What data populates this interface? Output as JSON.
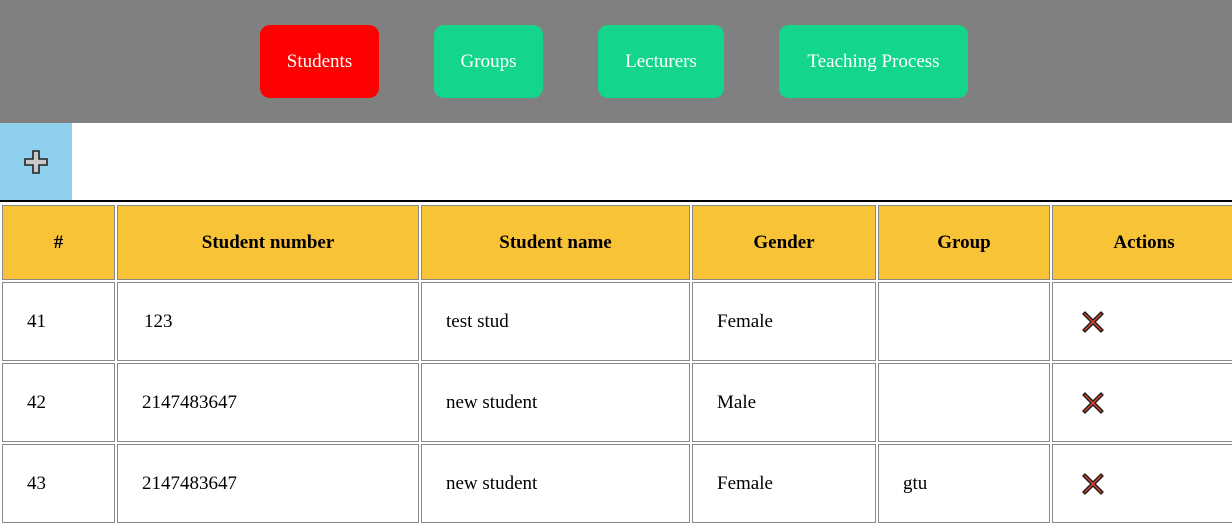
{
  "nav": {
    "students_label": "Students",
    "groups_label": "Groups",
    "lecturers_label": "Lecturers",
    "teaching_label": "Teaching Process"
  },
  "colors": {
    "navbar_bg": "#808080",
    "active_tab": "#ff0000",
    "tab": "#13d68c",
    "add_button_bg": "#8fd0ec",
    "header_bg": "#f9c338",
    "delete_icon": "#e0442c"
  },
  "toolbar": {
    "add_icon": "plus-icon"
  },
  "table": {
    "columns": [
      "#",
      "Student number",
      "Student name",
      "Gender",
      "Group",
      "Actions"
    ],
    "rows": [
      {
        "id": "41",
        "number": "123",
        "name": "test stud",
        "gender": "Female",
        "group": "",
        "action_icon": "delete-x-icon"
      },
      {
        "id": "42",
        "number": "2147483647",
        "name": "new student",
        "gender": "Male",
        "group": "",
        "action_icon": "delete-x-icon"
      },
      {
        "id": "43",
        "number": "2147483647",
        "name": "new student",
        "gender": "Female",
        "group": "gtu",
        "action_icon": "delete-x-icon"
      }
    ]
  }
}
